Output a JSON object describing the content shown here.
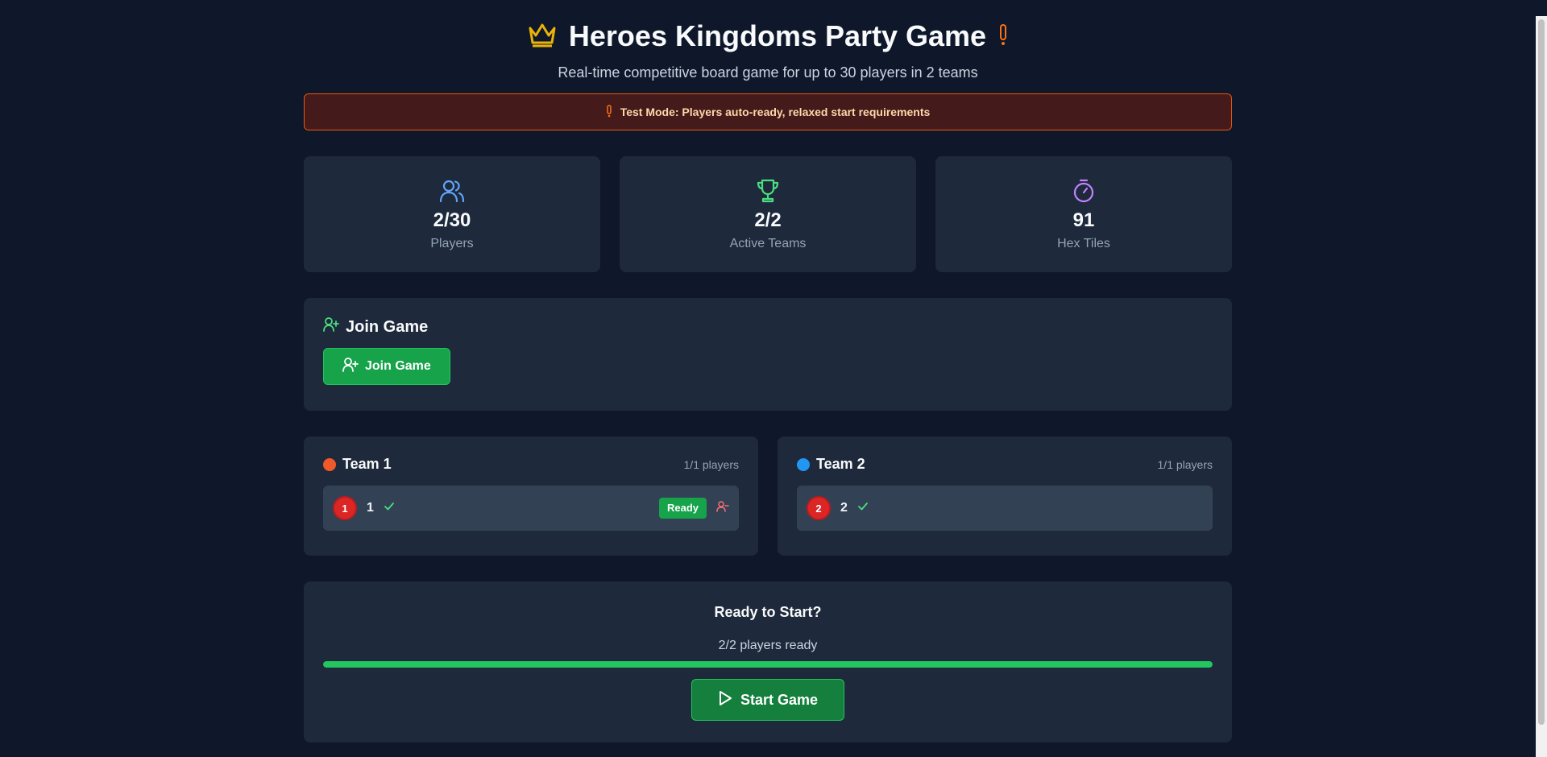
{
  "header": {
    "title": "Heroes Kingdoms Party Game",
    "subtitle": "Real-time competitive board game for up to 30 players in 2 teams",
    "title_icon": "crown-icon",
    "accent_icon": "exclamation-icon"
  },
  "banner": {
    "text": "Test Mode: Players auto-ready, relaxed start requirements",
    "icon": "exclamation-icon"
  },
  "stats": [
    {
      "icon": "users-icon",
      "value": "2/30",
      "label": "Players",
      "color": "#60a5fa"
    },
    {
      "icon": "trophy-icon",
      "value": "2/2",
      "label": "Active Teams",
      "color": "#4ade80"
    },
    {
      "icon": "timer-icon",
      "value": "91",
      "label": "Hex Tiles",
      "color": "#c084fc"
    }
  ],
  "join": {
    "heading": "Join Game",
    "button_label": "Join Game",
    "icon": "user-plus-icon"
  },
  "teams": [
    {
      "name": "Team 1",
      "count": "1/1 players",
      "color": "#f05a28",
      "players": [
        {
          "number": "1",
          "name": "1",
          "badge": "Ready"
        }
      ]
    },
    {
      "name": "Team 2",
      "count": "1/1 players",
      "color": "#2196f3",
      "players": [
        {
          "number": "2",
          "name": "2"
        }
      ]
    }
  ],
  "start": {
    "heading": "Ready to Start?",
    "ready_text": "2/2 players ready",
    "progress": 1.0,
    "button_label": "Start Game"
  },
  "colors": {
    "background": "#0f172a",
    "card": "#1e293b",
    "accent_green": "#16a34a",
    "crown": "#eab308",
    "warning": "#ea580c"
  }
}
